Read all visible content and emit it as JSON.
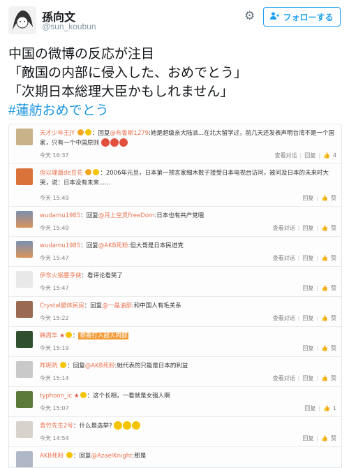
{
  "header": {
    "display_name": "孫向文",
    "handle": "@sun_koubun",
    "gear_icon": "gear-icon",
    "follow_label": "フォローする",
    "follow_icon": "person-plus-icon"
  },
  "tweet": {
    "lines": [
      "中国の微博の反応が注目",
      "「敵国の内部に侵入した、おめでとう」",
      "「次期日本総理大臣かもしれません」"
    ],
    "hashtag": "#蓮舫おめでとう"
  },
  "weibo": {
    "comments": [
      {
        "user": "天才少年王JY",
        "text_pre": "：回复",
        "reply_to": "@布鲁斯1279",
        "text": ":她是超级亲大陆派...在北大留学过，前几天还发表声明台湾不是一个国家，只有一个中国原则",
        "time": "今天 16:37",
        "actions": [
          "查看对话",
          "回复",
          "4"
        ]
      },
      {
        "user": "但以理篇de豆花",
        "text_pre": "：",
        "reply_to": "",
        "text": "2006年元旦，日本第一预言家细木数子接受日本电视台访问，被问及日本的未来时大哭，说：日本没有未来......",
        "time": "今天 15:49",
        "actions": [
          "回复",
          "赞"
        ]
      },
      {
        "user": "wudamu1985",
        "text_pre": "：回复",
        "reply_to": "@月上空灵FreeDom",
        "text": ":日本也有共产党哦",
        "time": "今天 15:49",
        "actions": [
          "查看对话",
          "回复",
          "赞"
        ]
      },
      {
        "user": "wudamu1985",
        "text_pre": "：回复",
        "reply_to": "@AKB死粉",
        "text": ":但大哥是日本民进党",
        "time": "今天 15:47",
        "actions": [
          "查看对话",
          "回复",
          "赞"
        ]
      },
      {
        "user": "伊东火锅要亨侠",
        "text_pre": "：",
        "reply_to": "",
        "text": "看评论看笑了",
        "time": "今天 15:47",
        "actions": [
          "回复",
          "赞"
        ]
      },
      {
        "user": "Crystal腿体民房",
        "text_pre": "：回复",
        "reply_to": "@一晶油部",
        "text": ":和中国人有毛关系",
        "time": "今天 15:22",
        "actions": [
          "查看对话",
          "回复",
          "赞"
        ]
      },
      {
        "user": "韩周华",
        "text_pre": "：",
        "reply_to": "",
        "text": "恭喜打入敌人内部",
        "time": "今天 15:19",
        "actions": [
          "回复",
          "赞"
        ]
      },
      {
        "user": "咋呢咣",
        "text_pre": "：回复",
        "reply_to": "@AKB死粉",
        "text": ":她代表的只能是日本的利益",
        "time": "今天 15:14",
        "actions": [
          "查看对话",
          "回复",
          "赞"
        ]
      },
      {
        "user": "typhoon_ic",
        "text_pre": "：",
        "reply_to": "",
        "text": "这个长相，一看就是女强人啊",
        "time": "今天 15:07",
        "actions": [
          "回复",
          "1"
        ]
      },
      {
        "user": "青竹先生2号",
        "text_pre": "：",
        "reply_to": "",
        "text": "什么是选举?",
        "time": "今天 14:54",
        "actions": [
          "回复",
          "赞"
        ]
      },
      {
        "user": "AKB死粉",
        "text_pre": "：回复",
        "reply_to": "@AzaelKnight",
        "text": ":那是",
        "time": "",
        "actions": []
      }
    ]
  }
}
